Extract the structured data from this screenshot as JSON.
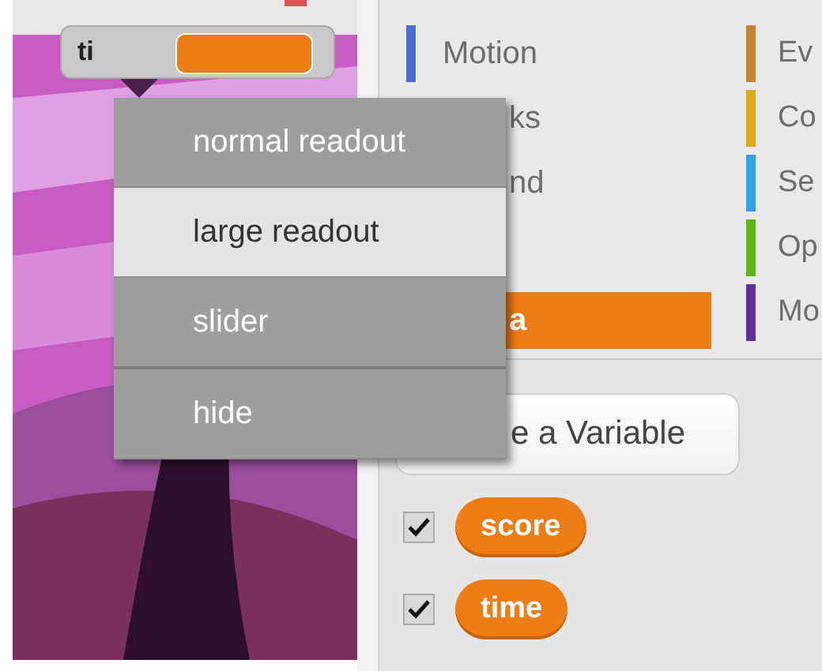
{
  "stage": {
    "monitor": {
      "label": "ti"
    }
  },
  "menu": {
    "items": [
      {
        "label": "normal readout",
        "selected": false,
        "divider_after": false
      },
      {
        "label": "large readout",
        "selected": true,
        "divider_after": false
      },
      {
        "label": "slider",
        "selected": false,
        "divider_after": true
      },
      {
        "label": "hide",
        "selected": false,
        "divider_after": false
      }
    ]
  },
  "categories": {
    "column_1": [
      {
        "label": "Motion",
        "color": "#4a6cd4",
        "selected": false
      },
      {
        "label": "ks",
        "selected": false,
        "covered": true
      },
      {
        "label": "nd",
        "selected": false,
        "covered": true
      },
      {
        "label": "a",
        "color": "#ee7d16",
        "selected": true,
        "covered": true
      }
    ],
    "column_2": [
      {
        "label": "Ev",
        "color": "#c88330",
        "selected": false
      },
      {
        "label": "Co",
        "color": "#e1a91a",
        "selected": false
      },
      {
        "label": "Se",
        "color": "#2ca5e2",
        "selected": false
      },
      {
        "label": "Op",
        "color": "#5cb712",
        "selected": false
      },
      {
        "label": "Mo",
        "color": "#632d99",
        "selected": false
      }
    ]
  },
  "make_variable_button": {
    "label": "e a Variable"
  },
  "variables": [
    {
      "label": "score",
      "checked": true
    },
    {
      "label": "time",
      "checked": true
    }
  ]
}
